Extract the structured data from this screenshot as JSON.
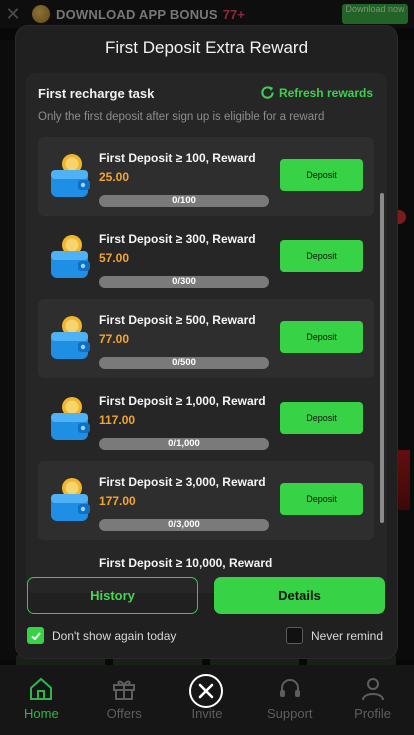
{
  "topbar": {
    "close_icon": "close-icon",
    "promo_text": "DOWNLOAD APP  BONUS",
    "promo_accent": "77+",
    "download_label": "Download now"
  },
  "modal": {
    "title": "First Deposit Extra Reward",
    "task_title": "First recharge task",
    "refresh_label": "Refresh rewards",
    "note": "Only the first deposit after sign up is eligible for a reward",
    "rewards": [
      {
        "label": "First Deposit ≥ 100, Reward",
        "amount": "25.00",
        "progress_text": "0/100",
        "progress": 0,
        "button": "Deposit"
      },
      {
        "label": "First Deposit ≥ 300, Reward",
        "amount": "57.00",
        "progress_text": "0/300",
        "progress": 0,
        "button": "Deposit"
      },
      {
        "label": "First Deposit ≥ 500, Reward",
        "amount": "77.00",
        "progress_text": "0/500",
        "progress": 0,
        "button": "Deposit"
      },
      {
        "label": "First Deposit ≥ 1,000, Reward",
        "amount": "117.00",
        "progress_text": "0/1,000",
        "progress": 0,
        "button": "Deposit"
      },
      {
        "label": "First Deposit ≥ 3,000, Reward",
        "amount": "177.00",
        "progress_text": "0/3,000",
        "progress": 0,
        "button": "Deposit"
      },
      {
        "label": "First Deposit ≥ 10,000, Reward"
      }
    ],
    "history_label": "History",
    "details_label": "Details",
    "dont_show_label": "Don't show again today",
    "dont_show_checked": true,
    "never_remind_label": "Never remind",
    "never_remind_checked": false
  },
  "bottom_nav": [
    {
      "label": "Home",
      "icon": "home-icon",
      "active": true
    },
    {
      "label": "Offers",
      "icon": "gift-icon",
      "active": false
    },
    {
      "label": "Invite",
      "icon": "invite-icon",
      "active": false
    },
    {
      "label": "Support",
      "icon": "headset-icon",
      "active": false
    },
    {
      "label": "Profile",
      "icon": "profile-icon",
      "active": false
    }
  ],
  "colors": {
    "accent_green": "#37d246",
    "amount_orange": "#f3a531",
    "promo_red": "#ff4b6b"
  }
}
